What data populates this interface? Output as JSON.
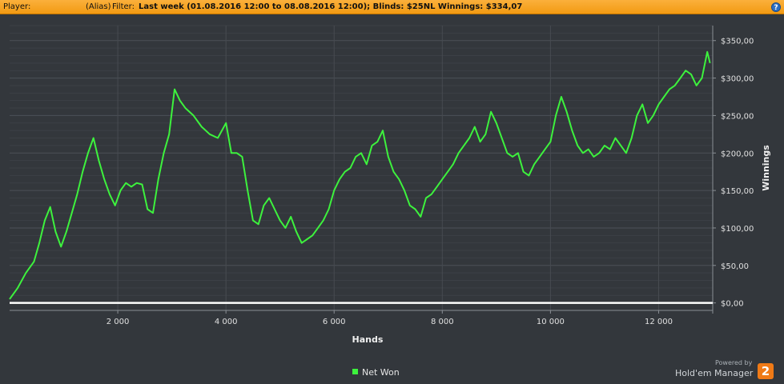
{
  "header": {
    "player_label": "Player:",
    "alias": "(Alias)",
    "filter_label": "Filter:",
    "filter_text": "Last week (01.08.2016 12:00 to 08.08.2016 12:00); Blinds: $25NL  Winnings:  $334,07",
    "help_symbol": "?"
  },
  "chart_data": {
    "type": "line",
    "xlabel": "Hands",
    "ylabel": "Winnings",
    "x_ticks": [
      2000,
      4000,
      6000,
      8000,
      10000,
      12000
    ],
    "x_tick_labels": [
      "2 000",
      "4 000",
      "6 000",
      "8 000",
      "10 000",
      "12 000"
    ],
    "y_ticks": [
      0,
      50,
      100,
      150,
      200,
      250,
      300,
      350
    ],
    "y_tick_labels": [
      "$0,00",
      "$50,00",
      "$100,00",
      "$150,00",
      "$200,00",
      "$250,00",
      "$300,00",
      "$350,00"
    ],
    "xlim": [
      0,
      13000
    ],
    "ylim": [
      -10,
      370
    ],
    "grid": true,
    "legend": "bottom-center",
    "series": [
      {
        "name": "Net Won",
        "color": "#3df23d",
        "x": [
          0,
          150,
          300,
          450,
          550,
          650,
          750,
          850,
          950,
          1050,
          1150,
          1250,
          1350,
          1450,
          1550,
          1650,
          1750,
          1850,
          1950,
          2050,
          2150,
          2250,
          2350,
          2450,
          2550,
          2650,
          2750,
          2850,
          2950,
          3050,
          3150,
          3250,
          3400,
          3550,
          3700,
          3850,
          4000,
          4100,
          4200,
          4300,
          4400,
          4500,
          4600,
          4700,
          4800,
          4900,
          5000,
          5100,
          5200,
          5300,
          5400,
          5500,
          5600,
          5700,
          5800,
          5900,
          6000,
          6100,
          6200,
          6300,
          6400,
          6500,
          6600,
          6700,
          6800,
          6900,
          7000,
          7100,
          7200,
          7300,
          7400,
          7500,
          7600,
          7700,
          7800,
          7900,
          8000,
          8100,
          8200,
          8300,
          8400,
          8500,
          8600,
          8700,
          8800,
          8900,
          9000,
          9100,
          9200,
          9300,
          9400,
          9500,
          9600,
          9700,
          9800,
          9900,
          10000,
          10100,
          10200,
          10300,
          10400,
          10500,
          10600,
          10700,
          10800,
          10900,
          11000,
          11100,
          11200,
          11300,
          11400,
          11500,
          11600,
          11700,
          11800,
          11900,
          12000,
          12100,
          12200,
          12300,
          12400,
          12500,
          12600,
          12700,
          12800,
          12900,
          12950
        ],
        "y": [
          5,
          20,
          40,
          55,
          80,
          110,
          128,
          95,
          75,
          95,
          120,
          145,
          175,
          200,
          220,
          190,
          165,
          145,
          130,
          150,
          160,
          155,
          160,
          158,
          125,
          120,
          165,
          200,
          225,
          285,
          270,
          260,
          250,
          235,
          225,
          220,
          240,
          200,
          200,
          195,
          150,
          110,
          105,
          130,
          140,
          125,
          110,
          100,
          115,
          95,
          80,
          85,
          90,
          100,
          110,
          125,
          150,
          165,
          175,
          180,
          195,
          200,
          185,
          210,
          215,
          230,
          195,
          175,
          165,
          150,
          130,
          125,
          115,
          140,
          145,
          155,
          165,
          175,
          185,
          200,
          210,
          220,
          235,
          215,
          225,
          255,
          240,
          220,
          200,
          195,
          200,
          175,
          170,
          185,
          195,
          205,
          215,
          250,
          275,
          255,
          230,
          210,
          200,
          205,
          195,
          200,
          210,
          205,
          220,
          210,
          200,
          220,
          250,
          265,
          240,
          250,
          265,
          275,
          285,
          290,
          300,
          310,
          305,
          290,
          300,
          335,
          320
        ]
      }
    ]
  },
  "legend": {
    "items": [
      {
        "label": "Net Won",
        "color": "#3df23d"
      }
    ]
  },
  "branding": {
    "powered_by": "Powered by",
    "product": "Hold'em Manager",
    "logo_text": "2"
  }
}
